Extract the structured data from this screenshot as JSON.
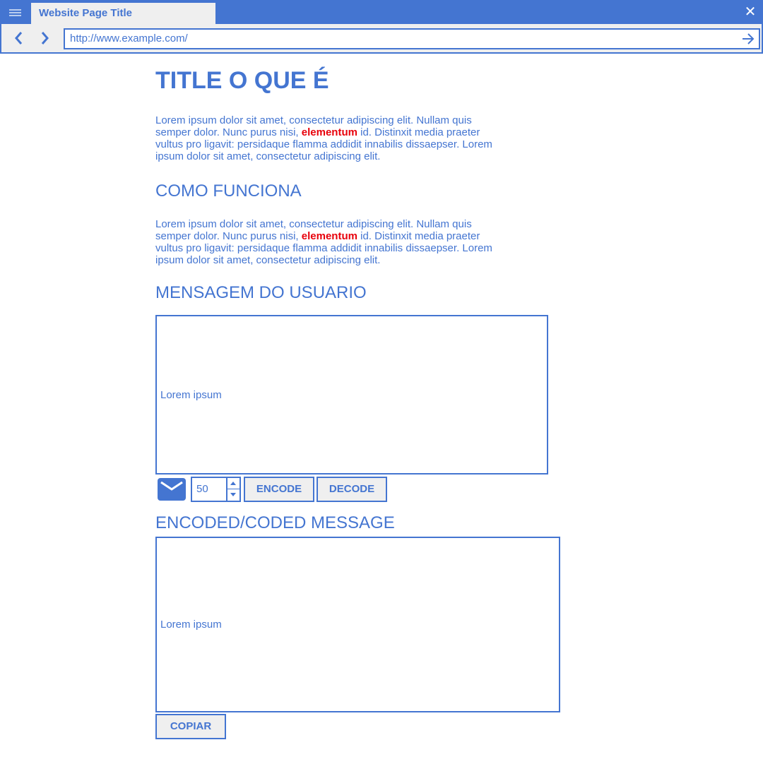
{
  "browser": {
    "tab_title": "Website Page Title",
    "url": "http://www.example.com/",
    "close_symbol": "✕",
    "icons": [
      "menu-icon",
      "close-icon",
      "back-arrow-icon",
      "forward-arrow-icon",
      "go-arrow-icon"
    ]
  },
  "page": {
    "title": "TITLE O QUE É",
    "intro": {
      "part1": "Lorem ipsum dolor sit amet, consectetur adipiscing elit. Nullam quis semper dolor. Nunc purus nisi, ",
      "highlight": "elementum",
      "part2": " id. Distinxit  media praeter vultus pro ligavit: persidaque flamma addidit innabilis dissaepser. Lorem ipsum dolor sit amet, consectetur adipiscing elit."
    },
    "how_heading": "COMO FUNCIONA",
    "how": {
      "part1": "Lorem ipsum dolor sit amet, consectetur adipiscing elit. Nullam quis semper dolor. Nunc purus nisi, ",
      "highlight": "elementum",
      "part2": " id. Distinxit  media praeter vultus pro ligavit: persidaque flamma addidit innabilis dissaepser. Lorem ipsum dolor sit amet, consectetur adipiscing elit."
    },
    "user_message_heading": "MENSAGEM DO USUARIO",
    "user_message_text": "Lorem ipsum",
    "controls": {
      "icon": "envelope-icon",
      "shift_value": "50",
      "encode_label": "ENCODE",
      "decode_label": "DECODE"
    },
    "encoded_heading": "ENCODED/CODED MESSAGE",
    "encoded_text": "Lorem ipsum",
    "copy_label": "COPIAR"
  },
  "colors": {
    "accent": "#4475d1",
    "highlight": "#e8000b",
    "chrome_bg": "#efefef"
  }
}
